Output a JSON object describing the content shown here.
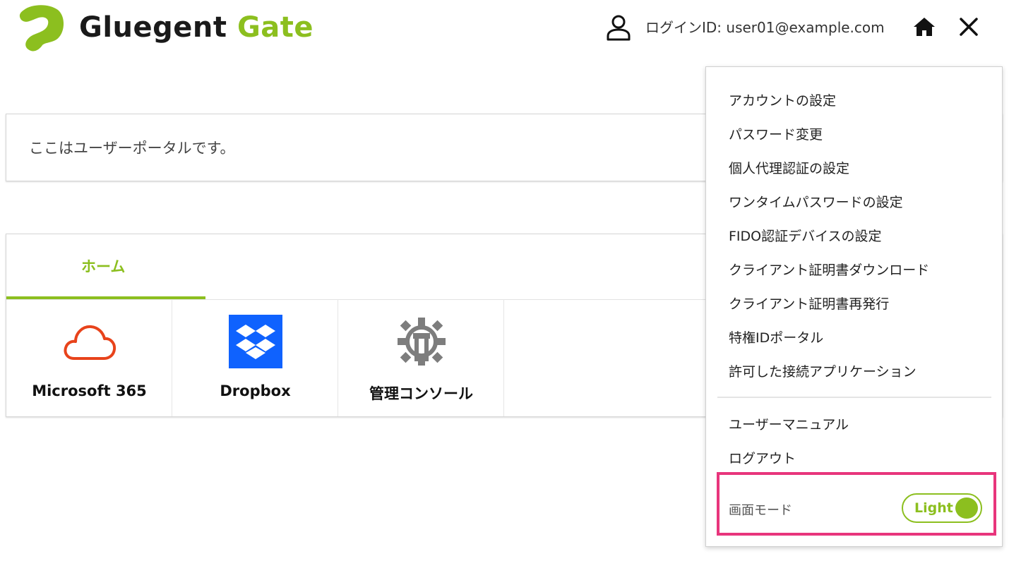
{
  "header": {
    "brand_primary": "Gluegent",
    "brand_secondary": "Gate",
    "login_text": "ログインID: user01@example.com"
  },
  "message": {
    "text": "ここはユーザーポータルです。"
  },
  "tabs": [
    {
      "label": "ホーム",
      "active": true
    }
  ],
  "apps": [
    {
      "label": "Microsoft 365",
      "icon": "cloud-icon"
    },
    {
      "label": "Dropbox",
      "icon": "dropbox-icon"
    },
    {
      "label": "管理コンソール",
      "icon": "gear-wrench-icon"
    }
  ],
  "menu": {
    "items": [
      "アカウントの設定",
      "パスワード変更",
      "個人代理認証の設定",
      "ワンタイムパスワードの設定",
      "FIDO認証デバイスの設定",
      "クライアント証明書ダウンロード",
      "クライアント証明書再発行",
      "特権IDポータル",
      "許可した接続アプリケーション"
    ],
    "secondary_items": [
      "ユーザーマニュアル",
      "ログアウト"
    ],
    "mode_label": "画面モード",
    "mode_value": "Light"
  },
  "colors": {
    "accent": "#8cbf1f",
    "highlight": "#e8357c",
    "office_red": "#e8431b",
    "dropbox_blue": "#0f62fe"
  }
}
